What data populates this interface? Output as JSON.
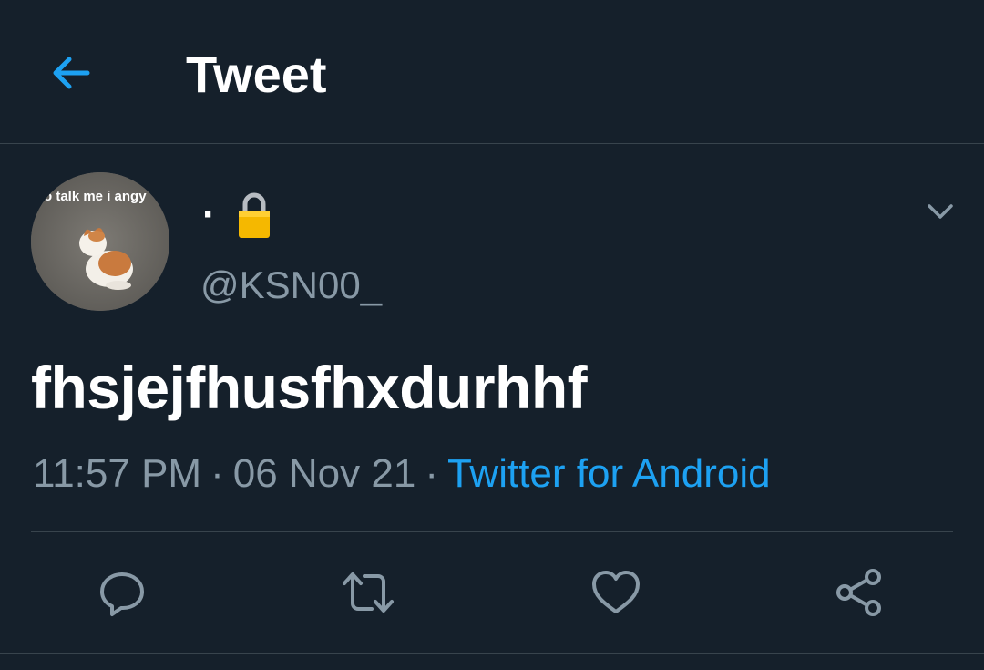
{
  "header": {
    "title": "Tweet",
    "back_icon": "arrow-left-icon",
    "accent_color": "#1da1f2"
  },
  "author": {
    "display_name": "·",
    "handle": "@KSN00_",
    "protected_icon": "lock-icon",
    "avatar_caption": "o talk me i angy"
  },
  "tweet": {
    "text": "fhsjejfhusfhxdurhhf",
    "time": "11:57 PM",
    "date": "06 Nov 21",
    "separator": "·",
    "source": "Twitter for Android"
  },
  "actions": [
    {
      "name": "reply",
      "icon": "reply-icon"
    },
    {
      "name": "retweet",
      "icon": "retweet-icon"
    },
    {
      "name": "like",
      "icon": "heart-icon"
    },
    {
      "name": "share",
      "icon": "share-icon"
    }
  ],
  "colors": {
    "background": "#15202b",
    "border": "#38444d",
    "secondary_text": "#8899a6",
    "primary_text": "#ffffff",
    "link": "#1da1f2"
  }
}
